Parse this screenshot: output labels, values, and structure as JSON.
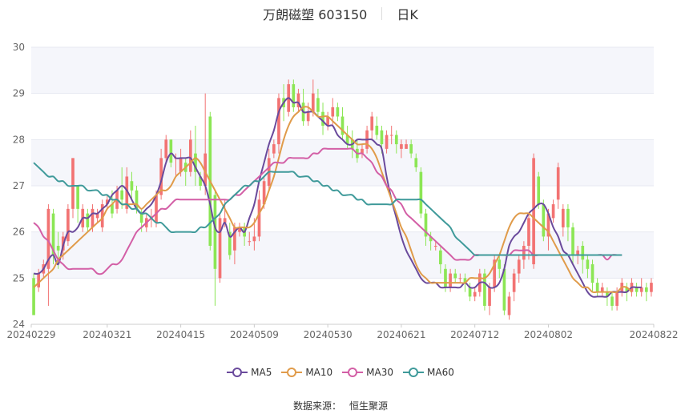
{
  "header": {
    "title": "万朗磁塑 603150",
    "period": "日K"
  },
  "source": {
    "label": "数据来源：",
    "value": "恒生聚源"
  },
  "colors": {
    "up": "#f27373",
    "down": "#8ce655",
    "MA5": "#6a4a9c",
    "MA10": "#e09b4a",
    "MA30": "#d35fa6",
    "MA60": "#3f9a9a"
  },
  "chart_data": {
    "type": "candlestick",
    "title": "万朗磁塑 603150",
    "ylim": [
      24,
      30
    ],
    "yticks": [
      "24",
      "25",
      "26",
      "27",
      "28",
      "29",
      "30"
    ],
    "xtick_labels": [
      "20240229",
      "20240321",
      "20240415",
      "20240509",
      "20240530",
      "20240621",
      "20240712",
      "20240802",
      "20240822"
    ],
    "xtick_index": [
      0,
      15,
      30,
      45,
      60,
      75,
      90,
      105,
      120
    ],
    "grid": true,
    "legend_position": "bottom",
    "candles": [
      [
        25.0,
        24.2,
        25.1,
        24.2
      ],
      [
        24.8,
        25.1,
        25.2,
        24.7
      ],
      [
        25.1,
        25.3,
        25.4,
        25.0
      ],
      [
        25.2,
        26.5,
        26.6,
        24.4
      ],
      [
        26.4,
        25.5,
        26.5,
        25.3
      ],
      [
        25.7,
        25.6,
        26.0,
        25.2
      ],
      [
        25.6,
        25.9,
        26.0,
        25.4
      ],
      [
        25.8,
        26.5,
        26.6,
        25.7
      ],
      [
        26.5,
        27.6,
        27.6,
        26.3
      ],
      [
        27.0,
        26.5,
        27.0,
        26.2
      ],
      [
        26.1,
        26.5,
        26.6,
        26.0
      ],
      [
        26.4,
        26.1,
        26.5,
        26.0
      ],
      [
        26.1,
        26.5,
        26.6,
        26.0
      ],
      [
        26.3,
        26.4,
        26.5,
        26.2
      ],
      [
        26.1,
        26.6,
        26.7,
        26.0
      ],
      [
        26.6,
        26.7,
        26.8,
        26.5
      ],
      [
        26.6,
        26.4,
        26.9,
        26.3
      ],
      [
        26.5,
        26.9,
        27.0,
        26.4
      ],
      [
        26.9,
        26.7,
        27.4,
        26.5
      ],
      [
        26.5,
        27.2,
        27.4,
        26.4
      ],
      [
        27.1,
        26.9,
        27.3,
        26.7
      ],
      [
        26.9,
        26.5,
        27.0,
        26.4
      ],
      [
        26.4,
        26.2,
        26.5,
        26.0
      ],
      [
        26.1,
        26.3,
        26.4,
        26.0
      ],
      [
        26.3,
        26.3,
        26.5,
        26.1
      ],
      [
        26.2,
        26.8,
        26.9,
        26.1
      ],
      [
        26.8,
        27.6,
        27.8,
        26.7
      ],
      [
        27.6,
        28.0,
        28.1,
        27.5
      ],
      [
        28.0,
        27.5,
        28.0,
        27.4
      ],
      [
        27.6,
        27.6,
        27.7,
        27.2
      ],
      [
        27.3,
        27.6,
        27.8,
        27.2
      ],
      [
        27.5,
        27.3,
        27.6,
        27.0
      ],
      [
        27.3,
        28.0,
        28.2,
        27.2
      ],
      [
        27.7,
        27.3,
        28.3,
        27.0
      ],
      [
        27.2,
        27.0,
        27.3,
        26.9
      ],
      [
        27.0,
        27.7,
        29.0,
        26.8
      ],
      [
        28.5,
        25.7,
        28.6,
        25.6
      ],
      [
        26.8,
        25.2,
        26.9,
        24.4
      ],
      [
        25.0,
        26.3,
        26.4,
        24.9
      ],
      [
        26.2,
        26.3,
        26.7,
        26.1
      ],
      [
        26.0,
        25.5,
        26.2,
        25.4
      ],
      [
        25.6,
        26.1,
        26.2,
        25.3
      ],
      [
        26.0,
        26.1,
        26.2,
        25.9
      ],
      [
        26.1,
        25.9,
        26.2,
        25.7
      ],
      [
        25.8,
        25.8,
        26.0,
        25.7
      ],
      [
        25.8,
        25.9,
        26.3,
        25.6
      ],
      [
        25.9,
        26.7,
        26.9,
        25.8
      ],
      [
        26.6,
        27.1,
        27.2,
        26.5
      ],
      [
        27.0,
        27.6,
        27.8,
        26.9
      ],
      [
        27.7,
        27.9,
        28.0,
        27.6
      ],
      [
        27.9,
        28.9,
        29.0,
        27.7
      ],
      [
        28.9,
        28.7,
        29.2,
        28.4
      ],
      [
        28.6,
        29.2,
        29.3,
        28.5
      ],
      [
        29.2,
        28.7,
        29.3,
        28.6
      ],
      [
        28.7,
        29.0,
        29.1,
        28.6
      ],
      [
        28.8,
        28.4,
        29.1,
        28.3
      ],
      [
        28.4,
        28.6,
        28.8,
        28.3
      ],
      [
        28.6,
        29.0,
        29.3,
        28.5
      ],
      [
        28.9,
        28.6,
        29.1,
        28.5
      ],
      [
        28.6,
        28.3,
        28.8,
        28.1
      ],
      [
        28.3,
        28.5,
        28.6,
        28.2
      ],
      [
        28.5,
        28.7,
        28.9,
        28.3
      ],
      [
        28.7,
        28.5,
        28.8,
        28.4
      ],
      [
        28.5,
        28.1,
        28.7,
        28.0
      ],
      [
        28.1,
        27.9,
        28.3,
        27.8
      ],
      [
        28.0,
        27.8,
        28.2,
        27.6
      ],
      [
        27.8,
        27.6,
        28.0,
        27.5
      ],
      [
        27.7,
        27.8,
        27.9,
        27.6
      ],
      [
        27.8,
        28.2,
        28.3,
        27.7
      ],
      [
        28.2,
        28.5,
        28.6,
        28.0
      ],
      [
        28.3,
        28.1,
        28.5,
        28.0
      ],
      [
        28.2,
        27.9,
        28.3,
        27.7
      ],
      [
        27.8,
        28.1,
        28.2,
        27.7
      ],
      [
        28.1,
        28.1,
        28.3,
        27.9
      ],
      [
        28.1,
        27.9,
        28.2,
        27.7
      ],
      [
        27.8,
        27.9,
        28.0,
        27.6
      ],
      [
        27.8,
        27.9,
        28.0,
        27.8
      ],
      [
        27.9,
        27.7,
        28.0,
        27.6
      ],
      [
        27.6,
        27.4,
        27.7,
        27.3
      ],
      [
        27.3,
        26.4,
        27.4,
        26.3
      ],
      [
        26.4,
        25.9,
        26.5,
        25.7
      ],
      [
        25.9,
        25.8,
        26.0,
        25.6
      ],
      [
        25.7,
        25.7,
        25.8,
        25.6
      ],
      [
        25.6,
        25.3,
        25.7,
        25.1
      ],
      [
        25.2,
        24.8,
        25.3,
        24.7
      ],
      [
        24.8,
        25.1,
        25.2,
        24.7
      ],
      [
        25.1,
        25.0,
        25.2,
        24.9
      ],
      [
        25.0,
        25.0,
        25.1,
        24.9
      ],
      [
        25.0,
        24.9,
        25.1,
        24.7
      ],
      [
        24.8,
        24.6,
        24.9,
        24.5
      ],
      [
        24.6,
        24.7,
        24.8,
        24.5
      ],
      [
        24.7,
        25.1,
        25.2,
        24.6
      ],
      [
        25.1,
        24.4,
        25.2,
        24.3
      ],
      [
        24.4,
        24.8,
        24.9,
        24.2
      ],
      [
        24.8,
        25.4,
        25.5,
        24.7
      ],
      [
        25.4,
        25.2,
        25.5,
        25.0
      ],
      [
        25.2,
        24.3,
        25.3,
        24.2
      ],
      [
        24.2,
        24.6,
        24.7,
        24.1
      ],
      [
        24.7,
        25.1,
        25.2,
        24.5
      ],
      [
        25.1,
        25.4,
        25.5,
        24.9
      ],
      [
        25.4,
        25.7,
        25.8,
        25.2
      ],
      [
        25.7,
        26.3,
        26.4,
        25.4
      ],
      [
        25.3,
        27.6,
        27.7,
        25.2
      ],
      [
        27.2,
        26.6,
        27.3,
        26.5
      ],
      [
        26.6,
        25.9,
        26.7,
        25.8
      ],
      [
        25.9,
        26.4,
        26.5,
        25.6
      ],
      [
        26.3,
        26.6,
        26.7,
        26.2
      ],
      [
        26.7,
        27.4,
        27.5,
        26.5
      ],
      [
        26.1,
        26.5,
        26.6,
        25.9
      ],
      [
        26.5,
        26.1,
        26.6,
        25.8
      ],
      [
        26.1,
        25.5,
        26.2,
        25.3
      ],
      [
        25.5,
        25.6,
        25.7,
        25.3
      ],
      [
        25.7,
        25.4,
        25.8,
        25.1
      ],
      [
        25.4,
        25.2,
        25.5,
        25.0
      ],
      [
        25.3,
        24.9,
        25.4,
        24.7
      ],
      [
        24.9,
        24.7,
        25.0,
        24.6
      ],
      [
        24.7,
        24.8,
        24.9,
        24.6
      ],
      [
        24.7,
        24.6,
        24.8,
        24.4
      ],
      [
        24.6,
        24.4,
        24.7,
        24.3
      ],
      [
        24.4,
        24.7,
        24.8,
        24.3
      ],
      [
        24.7,
        24.9,
        25.0,
        24.6
      ],
      [
        24.8,
        24.7,
        24.9,
        24.5
      ],
      [
        24.7,
        24.9,
        25.0,
        24.6
      ],
      [
        24.8,
        24.7,
        24.9,
        24.6
      ],
      [
        24.7,
        24.8,
        25.0,
        24.6
      ],
      [
        24.8,
        24.7,
        24.9,
        24.5
      ],
      [
        24.7,
        24.9,
        25.0,
        24.6
      ]
    ],
    "series": [
      {
        "name": "MA5",
        "values": [
          25.1,
          25.1,
          25.2,
          25.4,
          25.5,
          25.3,
          25.7,
          26.0,
          26.0,
          26.1,
          26.3,
          26.3,
          26.4,
          26.4,
          26.5,
          26.6,
          26.8,
          26.9,
          27.0,
          26.9,
          26.7,
          26.5,
          26.4,
          26.5,
          26.6,
          26.8,
          27.1,
          27.5,
          27.7,
          27.6,
          27.6,
          27.6,
          27.6,
          27.4,
          27.2,
          27.0,
          26.6,
          26.1,
          26.0,
          26.2,
          25.9,
          26.0,
          26.1,
          26.0,
          26.3,
          26.6,
          27.1,
          27.5,
          27.9,
          28.2,
          28.6,
          28.8,
          28.9,
          28.8,
          28.8,
          28.6,
          28.6,
          28.6,
          28.5,
          28.4,
          28.3,
          28.3,
          28.1,
          28.0,
          27.9,
          27.9,
          28.0,
          28.0,
          28.0,
          28.0,
          27.9,
          27.8,
          27.2,
          26.7,
          26.3,
          25.9,
          25.6,
          25.4,
          25.2,
          25.0,
          24.9,
          24.9,
          24.9,
          24.8,
          24.8,
          24.8,
          24.8,
          24.8,
          24.9,
          24.8,
          24.8,
          24.9,
          24.9,
          24.8,
          24.8,
          24.9,
          25.2,
          25.7,
          25.9,
          26.0,
          26.2,
          26.4,
          26.5,
          26.6,
          26.6,
          26.4,
          26.1,
          25.9,
          25.6,
          25.5,
          25.3,
          25.1,
          24.9,
          24.7,
          24.6,
          24.6,
          24.6,
          24.6,
          24.7,
          24.7,
          24.7,
          24.7,
          24.8,
          24.8,
          24.8
        ]
      },
      {
        "name": "MA10",
        "values": [
          24.8,
          24.9,
          25.0,
          25.1,
          25.2,
          25.4,
          25.5,
          25.6,
          25.7,
          25.8,
          25.9,
          26.0,
          26.1,
          26.2,
          26.3,
          26.5,
          26.6,
          26.7,
          26.6,
          26.6,
          26.6,
          26.6,
          26.5,
          26.6,
          26.7,
          26.8,
          26.9,
          26.9,
          27.0,
          27.2,
          27.3,
          27.4,
          27.5,
          27.6,
          27.5,
          27.3,
          27.1,
          26.9,
          26.7,
          26.5,
          26.3,
          26.1,
          26.1,
          26.1,
          26.1,
          26.2,
          26.4,
          26.6,
          26.9,
          27.2,
          27.6,
          28.0,
          28.3,
          28.5,
          28.6,
          28.7,
          28.7,
          28.6,
          28.5,
          28.5,
          28.5,
          28.4,
          28.3,
          28.2,
          28.1,
          28.0,
          27.9,
          27.9,
          27.9,
          27.8,
          27.6,
          27.3,
          27.0,
          26.7,
          26.4,
          26.1,
          25.9,
          25.6,
          25.3,
          25.1,
          25.0,
          24.9,
          24.9,
          24.9,
          24.9,
          24.9,
          24.9,
          24.9,
          24.9,
          25.0,
          25.0,
          25.0,
          25.0,
          25.1,
          25.3,
          25.5,
          25.8,
          26.1,
          26.3,
          26.4,
          26.4,
          26.4,
          26.3,
          26.2,
          26.1,
          26.0,
          25.8,
          25.6,
          25.4,
          25.2,
          25.0,
          24.9,
          24.8,
          24.8,
          24.7,
          24.7,
          24.7,
          24.7,
          24.7,
          24.7,
          24.8,
          24.8,
          24.7
        ]
      },
      {
        "name": "MA30",
        "values": [
          26.2,
          26.1,
          25.9,
          25.8,
          25.6,
          25.4,
          25.3,
          25.2,
          25.2,
          25.2,
          25.2,
          25.2,
          25.2,
          25.1,
          25.1,
          25.2,
          25.3,
          25.3,
          25.4,
          25.6,
          25.8,
          26.0,
          26.1,
          26.2,
          26.3,
          26.4,
          26.5,
          26.5,
          26.6,
          26.7,
          26.7,
          26.7,
          26.7,
          26.7,
          26.7,
          26.7,
          26.7,
          26.7,
          26.7,
          26.7,
          26.7,
          26.8,
          26.8,
          26.9,
          27.0,
          27.1,
          27.2,
          27.3,
          27.4,
          27.5,
          27.5,
          27.5,
          27.6,
          27.6,
          27.6,
          27.6,
          27.6,
          27.7,
          27.7,
          27.8,
          27.8,
          27.8,
          27.8,
          27.8,
          27.8,
          27.8,
          27.7,
          27.7,
          27.6,
          27.5,
          27.3,
          27.2,
          27.0,
          26.9,
          26.7,
          26.6,
          26.4,
          26.3,
          26.2,
          26.1,
          26.0,
          25.9,
          25.8,
          25.7,
          25.6,
          25.5,
          25.4,
          25.4,
          25.4,
          25.4,
          25.5,
          25.5,
          25.5,
          25.5,
          25.5,
          25.5,
          25.5,
          25.5,
          25.6,
          25.6,
          25.6,
          25.6,
          25.5,
          25.5,
          25.5,
          25.5,
          25.5,
          25.5,
          25.5,
          25.5,
          25.5,
          25.5,
          25.5,
          25.5,
          25.5,
          25.5,
          25.5,
          25.4,
          25.5,
          25.5,
          25.5
        ]
      },
      {
        "name": "MA60",
        "values": [
          27.5,
          27.4,
          27.3,
          27.2,
          27.2,
          27.1,
          27.1,
          27.0,
          27.0,
          27.0,
          27.0,
          26.9,
          26.9,
          26.9,
          26.8,
          26.8,
          26.7,
          26.7,
          26.6,
          26.6,
          26.5,
          26.5,
          26.4,
          26.4,
          26.3,
          26.2,
          26.2,
          26.1,
          26.0,
          26.0,
          26.0,
          26.0,
          26.0,
          26.0,
          26.1,
          26.1,
          26.2,
          26.3,
          26.4,
          26.6,
          26.7,
          26.8,
          26.9,
          27.0,
          27.0,
          27.1,
          27.1,
          27.2,
          27.3,
          27.3,
          27.3,
          27.3,
          27.3,
          27.3,
          27.2,
          27.2,
          27.2,
          27.1,
          27.1,
          27.0,
          27.0,
          26.9,
          26.9,
          26.8,
          26.8,
          26.8,
          26.7,
          26.7,
          26.6,
          26.6,
          26.6,
          26.6,
          26.6,
          26.6,
          26.7,
          26.7,
          26.7,
          26.7,
          26.7,
          26.7,
          26.6,
          26.5,
          26.4,
          26.3,
          26.2,
          26.1,
          25.9,
          25.8,
          25.7,
          25.6,
          25.5,
          25.5,
          25.5,
          25.5,
          25.5,
          25.5,
          25.5,
          25.5,
          25.5,
          25.5,
          25.5,
          25.5,
          25.5,
          25.5,
          25.5,
          25.5,
          25.5,
          25.5,
          25.5,
          25.5,
          25.5,
          25.5,
          25.5,
          25.5,
          25.5,
          25.5,
          25.5,
          25.5,
          25.5,
          25.5,
          25.5
        ]
      }
    ]
  }
}
